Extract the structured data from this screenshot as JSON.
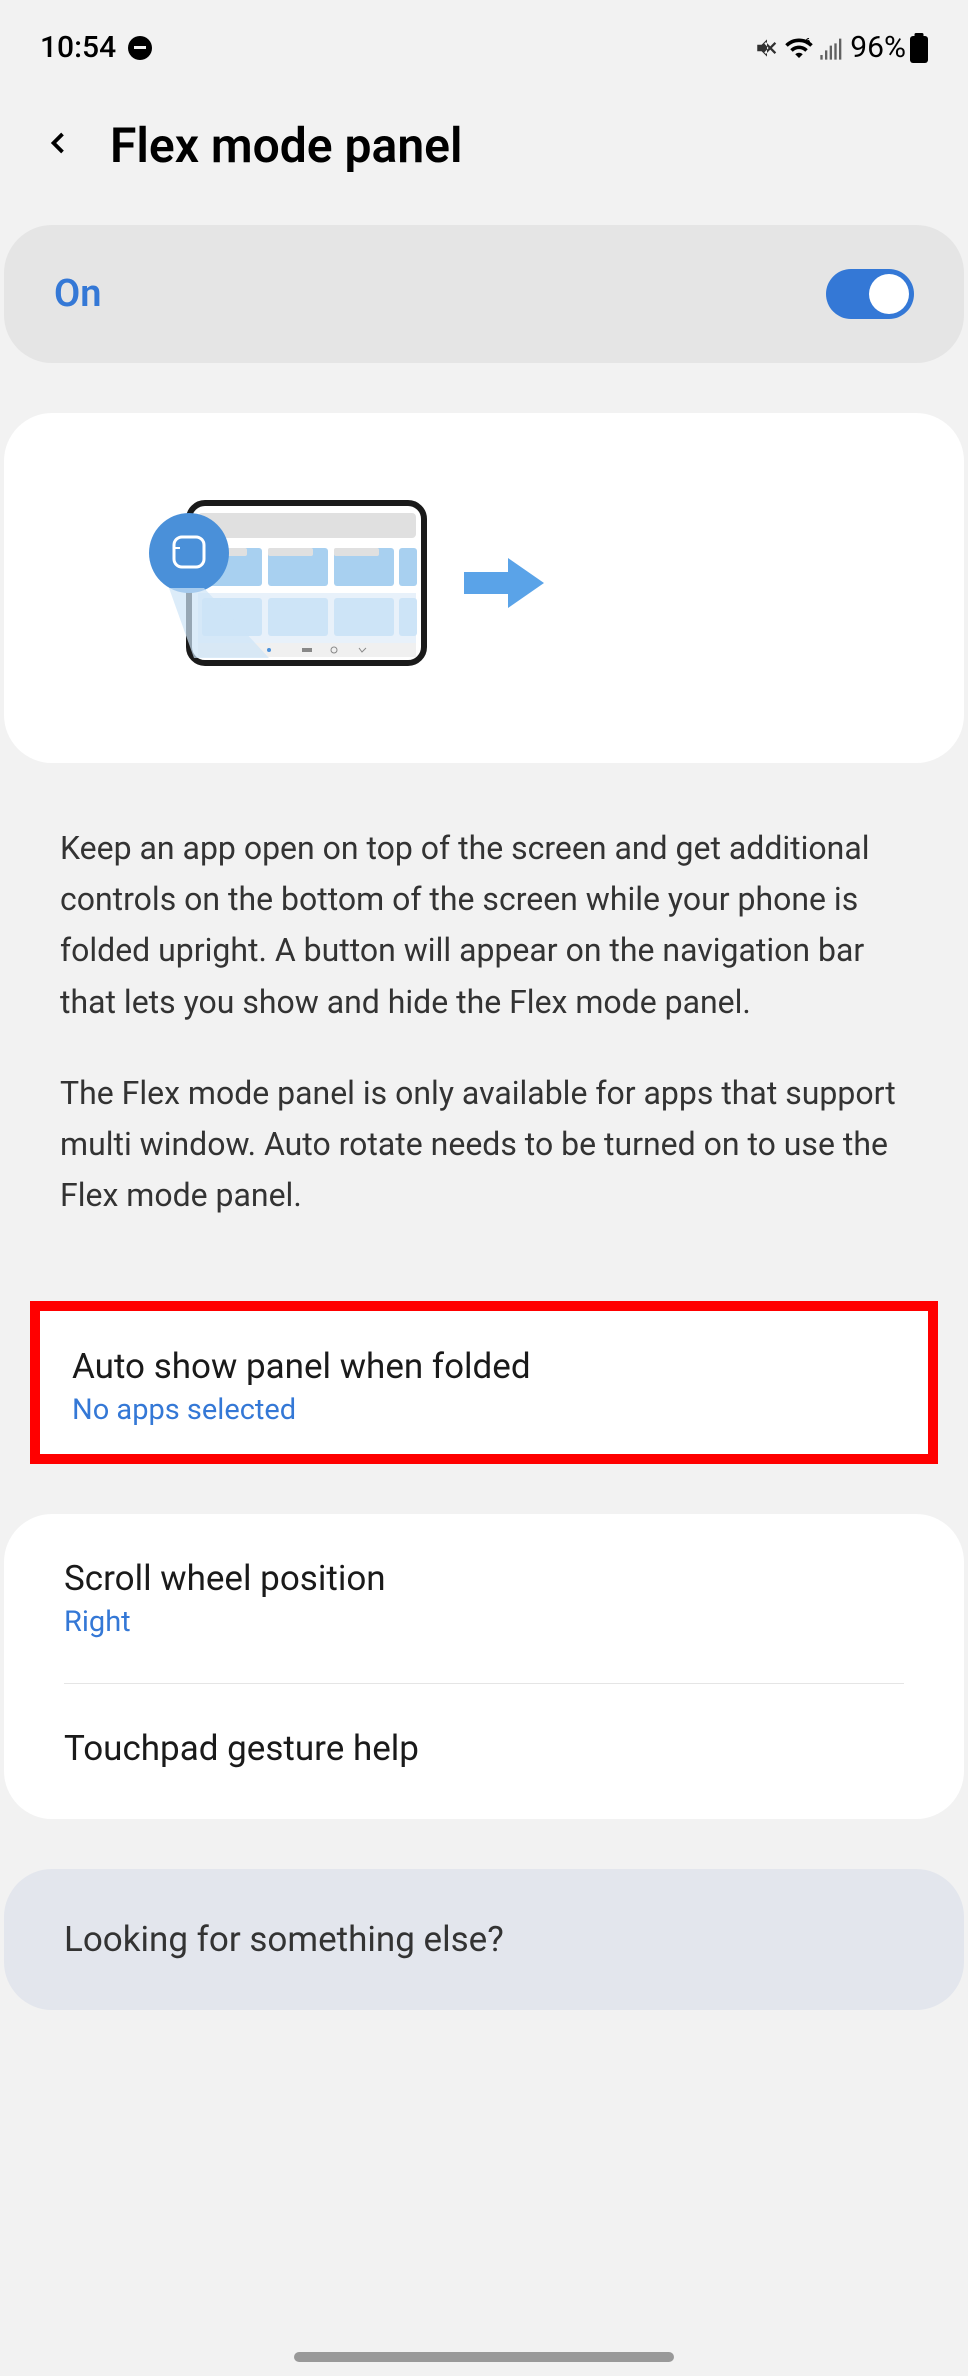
{
  "statusBar": {
    "time": "10:54",
    "battery": "96%"
  },
  "header": {
    "title": "Flex mode panel"
  },
  "mainToggle": {
    "label": "On",
    "enabled": true
  },
  "description": {
    "para1": "Keep an app open on top of the screen and get additional controls on the bottom of the screen while your phone is folded upright. A button will appear on the navigation bar that lets you show and hide the Flex mode panel.",
    "para2": "The Flex mode panel is only available for apps that support multi window. Auto rotate needs to be turned on to use the Flex mode panel."
  },
  "settings": {
    "autoShow": {
      "title": "Auto show panel when folded",
      "value": "No apps selected"
    },
    "scrollWheel": {
      "title": "Scroll wheel position",
      "value": "Right"
    },
    "touchpad": {
      "title": "Touchpad gesture help"
    }
  },
  "footer": {
    "text": "Looking for something else?"
  }
}
